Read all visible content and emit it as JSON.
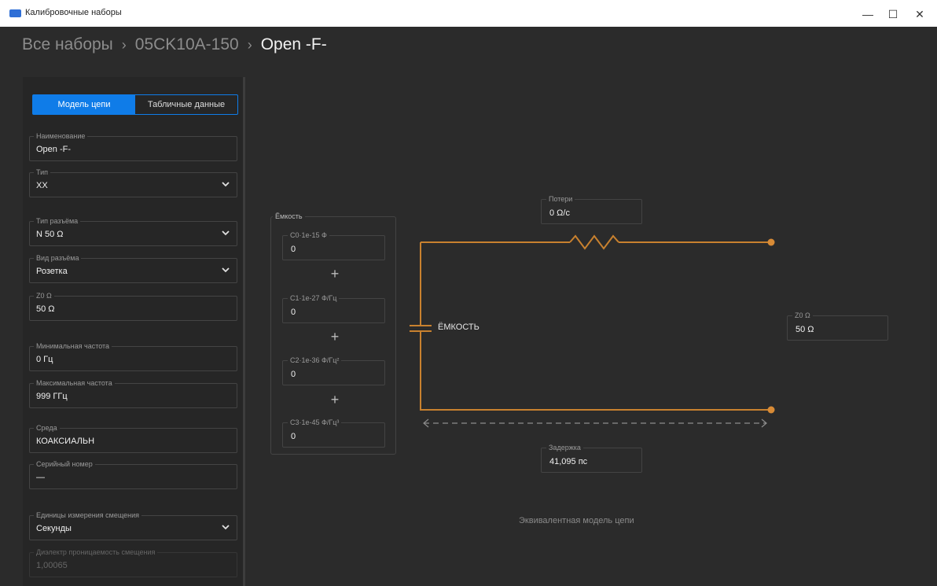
{
  "window": {
    "title": "Калибровочные наборы",
    "controls": {
      "minimize": "—",
      "maximize": "☐",
      "close": "✕"
    }
  },
  "breadcrumb": {
    "items": [
      "Все наборы",
      "05CK10A-150",
      "Open -F-"
    ],
    "separator": "›"
  },
  "tabs": {
    "model": "Модель цепи",
    "table": "Табличные данные",
    "active": "model"
  },
  "fields": {
    "name": {
      "label": "Наименование",
      "value": "Open -F-"
    },
    "type": {
      "label": "Тип",
      "value": "XX"
    },
    "connector_type": {
      "label": "Тип разъёма",
      "value": "N 50 Ω"
    },
    "connector_kind": {
      "label": "Вид разъёма",
      "value": "Розетка"
    },
    "z0": {
      "label": "Z0 Ω",
      "value": "50 Ω"
    },
    "min_freq": {
      "label": "Минимальная частота",
      "value": "0 Гц"
    },
    "max_freq": {
      "label": "Максимальная частота",
      "value": "999 ГГц"
    },
    "medium": {
      "label": "Среда",
      "value": "КОАКСИАЛЬН"
    },
    "serial": {
      "label": "Серийный номер",
      "value": "—"
    },
    "offset_units": {
      "label": "Единицы измерения смещения",
      "value": "Секунды"
    },
    "dielectric": {
      "label": "Диэлектр проницаемость смещения",
      "value": "1,00065"
    }
  },
  "capacitance": {
    "title": "Ёмкость",
    "c0": {
      "label": "C0·1e-15 Ф",
      "value": "0"
    },
    "c1": {
      "label": "C1·1e-27 Ф/Гц",
      "value": "0"
    },
    "c2": {
      "label": "C2·1e-36 Ф/Гц²",
      "value": "0"
    },
    "c3": {
      "label": "C3·1e-45 Ф/Гц³",
      "value": "0"
    },
    "plus": "+"
  },
  "circuit": {
    "loss": {
      "label": "Потери",
      "value": "0 Ω/с"
    },
    "z0": {
      "label": "Z0 Ω",
      "value": "50 Ω"
    },
    "delay": {
      "label": "Задержка",
      "value": "41,095 пс"
    },
    "capacitor_label": "ЁМКОСТЬ",
    "caption": "Эквивалентная модель цепи",
    "wire_color": "#c8812f"
  },
  "colors": {
    "accent": "#0f7ce8",
    "background": "#2b2b2b",
    "panel": "#262626"
  }
}
